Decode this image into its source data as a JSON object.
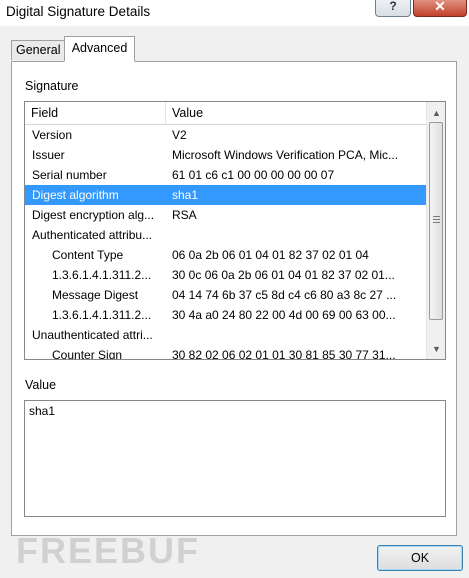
{
  "window": {
    "title": "Digital Signature Details",
    "help_glyph": "?",
    "close_glyph": "✕"
  },
  "tabs": [
    {
      "label": "General",
      "active": false
    },
    {
      "label": "Advanced",
      "active": true
    }
  ],
  "signature_section": {
    "label": "Signature"
  },
  "table": {
    "headers": {
      "field": "Field",
      "value": "Value"
    },
    "rows": [
      {
        "field": "Version",
        "value": "V2",
        "child": false,
        "selected": false
      },
      {
        "field": "Issuer",
        "value": "Microsoft Windows Verification PCA, Mic...",
        "child": false,
        "selected": false
      },
      {
        "field": "Serial number",
        "value": "61 01 c6 c1 00 00 00 00 00 07",
        "child": false,
        "selected": false
      },
      {
        "field": "Digest algorithm",
        "value": "sha1",
        "child": false,
        "selected": true
      },
      {
        "field": "Digest encryption alg...",
        "value": "RSA",
        "child": false,
        "selected": false
      },
      {
        "field": "Authenticated attribu...",
        "value": "",
        "child": false,
        "selected": false
      },
      {
        "field": "Content Type",
        "value": "06 0a 2b 06 01 04 01 82 37 02 01 04",
        "child": true,
        "selected": false
      },
      {
        "field": "1.3.6.1.4.1.311.2...",
        "value": "30 0c 06 0a 2b 06 01 04 01 82 37 02 01...",
        "child": true,
        "selected": false
      },
      {
        "field": "Message Digest",
        "value": "04 14 74 6b 37 c5 8d c4 c6 80 a3 8c 27 ...",
        "child": true,
        "selected": false
      },
      {
        "field": "1.3.6.1.4.1.311.2...",
        "value": "30 4a a0 24 80 22 00 4d 00 69 00 63 00...",
        "child": true,
        "selected": false
      },
      {
        "field": "Unauthenticated attri...",
        "value": "",
        "child": false,
        "selected": false
      },
      {
        "field": "Counter Sign",
        "value": "30 82 02 06 02 01 01 30 81 85 30 77 31...",
        "child": true,
        "selected": false
      }
    ]
  },
  "value_section": {
    "label": "Value",
    "content": "sha1"
  },
  "watermark": "FREEBUF",
  "buttons": {
    "ok": "OK"
  },
  "colors": {
    "selection": "#3399ff",
    "panel": "#ffffff",
    "dialog": "#f0f0f0"
  },
  "icons": {
    "scroll_up": "▲",
    "scroll_down": "▼"
  }
}
